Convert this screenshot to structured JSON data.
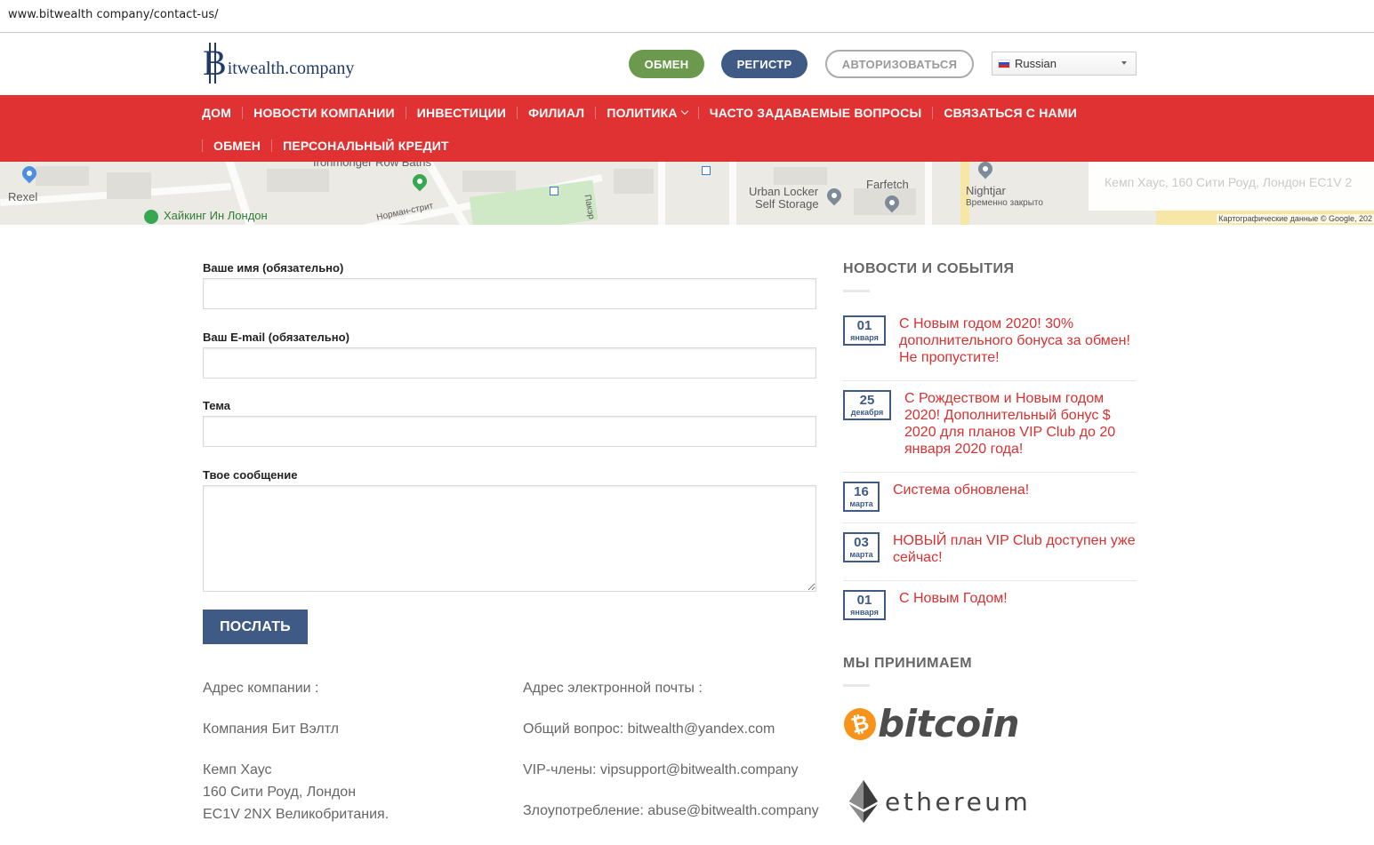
{
  "browser": {
    "url": "www.bitwealth company/contact-us/"
  },
  "header": {
    "logo_initial": "B",
    "logo_rest": "itwealth.company",
    "btn_exchange": "ОБМЕН",
    "btn_register": "РЕГИСТР",
    "btn_login": "АВТОРИЗОВАТЬСЯ",
    "language": "Russian"
  },
  "nav": {
    "row1": [
      "ДОМ",
      "НОВОСТИ КОМПАНИИ",
      "ИНВЕСТИЦИИ",
      "ФИЛИАЛ",
      "ПОЛИТИКА",
      "ЧАСТО ЗАДАВАЕМЫЕ ВОПРОСЫ",
      "СВЯЗАТЬСЯ С НАМИ"
    ],
    "row2": [
      "ОБМЕН",
      "ПЕРСОНАЛЬНЫЙ КРЕДИТ"
    ]
  },
  "map": {
    "labels": {
      "rexel": "Rexel",
      "ironmonger": "Ironmonger Row Baths",
      "hiking": "Хайкинг Ин Лондон",
      "norman_street": "Норман-стрит",
      "paxter": "Пакэр",
      "urban_locker_1": "Urban Locker",
      "urban_locker_2": "Self Storage",
      "farfetch": "Farfetch",
      "nightjar": "Nightjar",
      "nightjar_status": "Временно закрыто"
    },
    "overlay_text": "Кемп Хаус, 160 Сити Роуд, Лондон EC1V 2",
    "attribution": "Картографические данные © Google, 202"
  },
  "form": {
    "name_label": "Ваше имя (обязательно)",
    "email_label": "Ваш E-mail (обязательно)",
    "subject_label": "Тема",
    "message_label": "Твое сообщение",
    "name_value": "",
    "email_value": "",
    "subject_value": "",
    "message_value": "",
    "submit_label": "ПОСЛАТЬ"
  },
  "contact": {
    "address_title": "Адрес компании :",
    "company_name": "Компания Бит Вэлтл",
    "address_line1": "Кемп Хаус",
    "address_line2": "160 Сити Роуд, Лондон",
    "address_line3": "EC1V 2NX Великобритания.",
    "email_title": "Адрес электронной почты :",
    "general_email": "Общий вопрос: bitwealth@yandex.com",
    "vip_email": "VIP-члены: vipsupport@bitwealth.company",
    "abuse_email": "Злоупотребление: abuse@bitwealth.company"
  },
  "sidebar": {
    "news_title": "НОВОСТИ И СОБЫТИЯ",
    "news": [
      {
        "day": "01",
        "month": "января",
        "text": "С Новым годом 2020! 30% дополнительного бонуса за обмен! Не пропустите!"
      },
      {
        "day": "25",
        "month": "декабря",
        "text": "С Рождеством и Новым годом 2020! Дополнительный бонус $ 2020 для планов VIP Club до 20 января 2020 года!"
      },
      {
        "day": "16",
        "month": "марта",
        "text": "Система обновлена!"
      },
      {
        "day": "03",
        "month": "марта",
        "text": "НОВЫЙ план VIP Club доступен уже сейчас!"
      },
      {
        "day": "01",
        "month": "января",
        "text": "С Новым Годом!"
      }
    ],
    "accept_title": "МЫ ПРИНИМАЕМ",
    "bitcoin_symbol": "₿",
    "bitcoin_word": "bitcoin",
    "ethereum_word": "ethereum"
  },
  "colors": {
    "nav_red": "#e03232",
    "brand_blue": "#3e5a85",
    "exchange_green": "#6b9a4f",
    "news_red": "#d93030",
    "bitcoin_orange": "#f7931a"
  }
}
